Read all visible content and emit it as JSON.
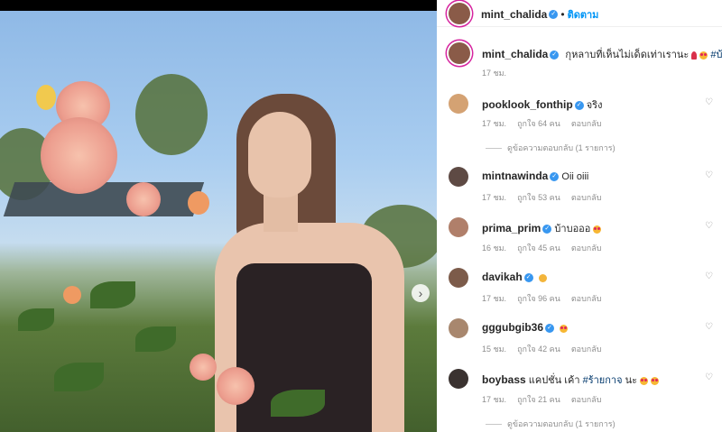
{
  "post": {
    "author": "mint_chalida",
    "follow_label": "ติดตาม",
    "dot": "•",
    "caption_text": "กุหลาบที่เห็นไม่เด็ดเท่าเรานะ",
    "caption_hashtag": "#บ้า",
    "caption_time": "17 ชม."
  },
  "carousel": {
    "next_icon": "chevron-right-icon",
    "next_glyph": "›"
  },
  "verified_glyph": "✓",
  "heart_glyph": "♡",
  "comments": [
    {
      "user": "pooklook_fonthip",
      "text": "จริง",
      "time": "17 ชม.",
      "likes": "ถูกใจ 64 คน",
      "reply": "ตอบกลับ",
      "replies": "ดูข้อความตอบกลับ (1 รายการ)"
    },
    {
      "user": "mintnawinda",
      "text": "Oii oiii",
      "time": "17 ชม.",
      "likes": "ถูกใจ 53 คน",
      "reply": "ตอบกลับ"
    },
    {
      "user": "prima_prim",
      "text": "บ้าบอออ",
      "time": "16 ชม.",
      "likes": "ถูกใจ 45 คน",
      "reply": "ตอบกลับ"
    },
    {
      "user": "davikah",
      "text": "",
      "time": "17 ชม.",
      "likes": "ถูกใจ 96 คน",
      "reply": "ตอบกลับ"
    },
    {
      "user": "gggubgib36",
      "text": "",
      "time": "15 ชม.",
      "likes": "ถูกใจ 42 คน",
      "reply": "ตอบกลับ"
    },
    {
      "user": "boybass",
      "text": "แคปชั่น เค้า",
      "hashtag": "#ร้ายกาจ",
      "suffix": "นะ",
      "time": "17 ชม.",
      "likes": "ถูกใจ 21 คน",
      "reply": "ตอบกลับ",
      "replies": "ดูข้อความตอบกลับ (1 รายการ)"
    }
  ]
}
